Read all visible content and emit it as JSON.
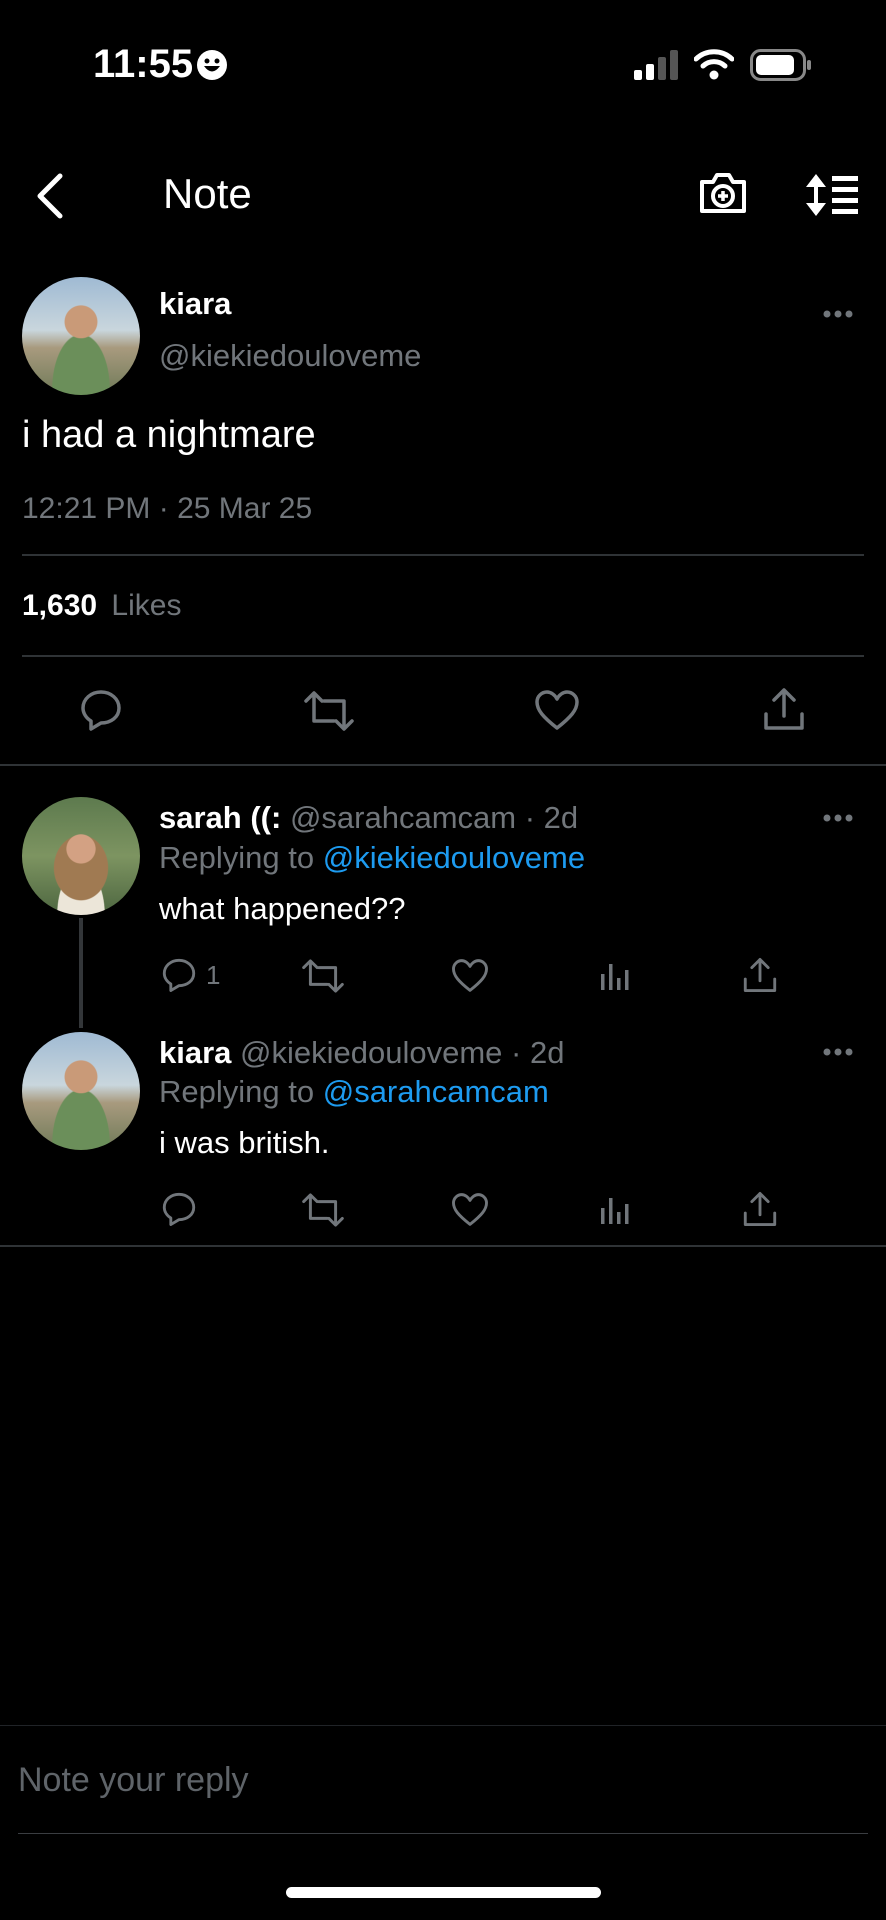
{
  "status_bar": {
    "time": "11:55"
  },
  "header": {
    "title": "Note"
  },
  "main_post": {
    "display_name": "kiara",
    "handle": "@kiekiedouloveme",
    "text": "i had a nightmare",
    "timestamp": "12:21 PM · 25 Mar 25",
    "likes_count": "1,630",
    "likes_label": "Likes"
  },
  "replies": [
    {
      "display_name": "sarah ((:",
      "meta": "@sarahcamcam · 2d",
      "replying_prefix": "Replying to",
      "replying_to": "@kiekiedouloveme",
      "text": "what happened??",
      "reply_count": "1"
    },
    {
      "display_name": "kiara",
      "meta": "@kiekiedouloveme · 2d",
      "replying_prefix": "Replying to",
      "replying_to": "@sarahcamcam",
      "text": "i was british.",
      "reply_count": ""
    }
  ],
  "composer": {
    "placeholder": "Note your reply"
  },
  "colors": {
    "background": "#000000",
    "text": "#e7e9ea",
    "secondary": "#71767b",
    "link": "#1d9bf0",
    "divider": "#2f3336"
  }
}
